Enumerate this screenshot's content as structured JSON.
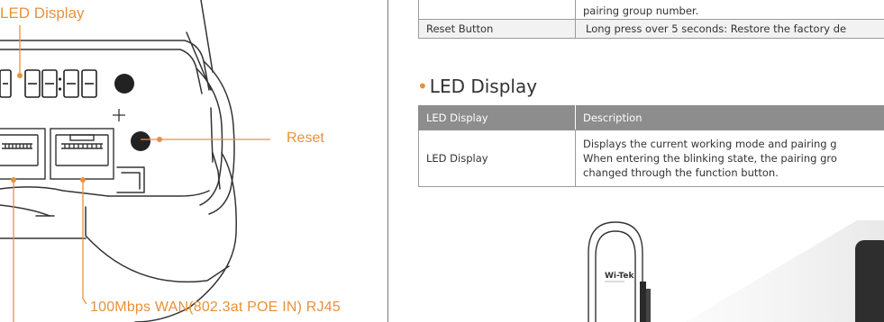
{
  "labels": {
    "led_display": "LED Display",
    "reset": "Reset",
    "wan_port": "100Mbps WAN(802.3at POE IN) RJ45"
  },
  "top_table": {
    "row1_value": "pairing group number.",
    "reset_label": "Reset Button",
    "reset_value": "Long press over 5 seconds: Restore the factory de"
  },
  "led_section": {
    "title": "LED Display",
    "header": [
      "LED Display",
      "Description"
    ],
    "row": {
      "name": "LED Display",
      "lines": [
        "Displays the current working mode and pairing g",
        "When entering the blinking state, the pairing gro",
        "changed through the function button."
      ]
    }
  },
  "device": {
    "logo": "Wi-Tek"
  },
  "colors": {
    "accent": "#e8913a",
    "header_bg": "#8d8d8d",
    "text": "#333333",
    "border": "#9a9a9a"
  }
}
